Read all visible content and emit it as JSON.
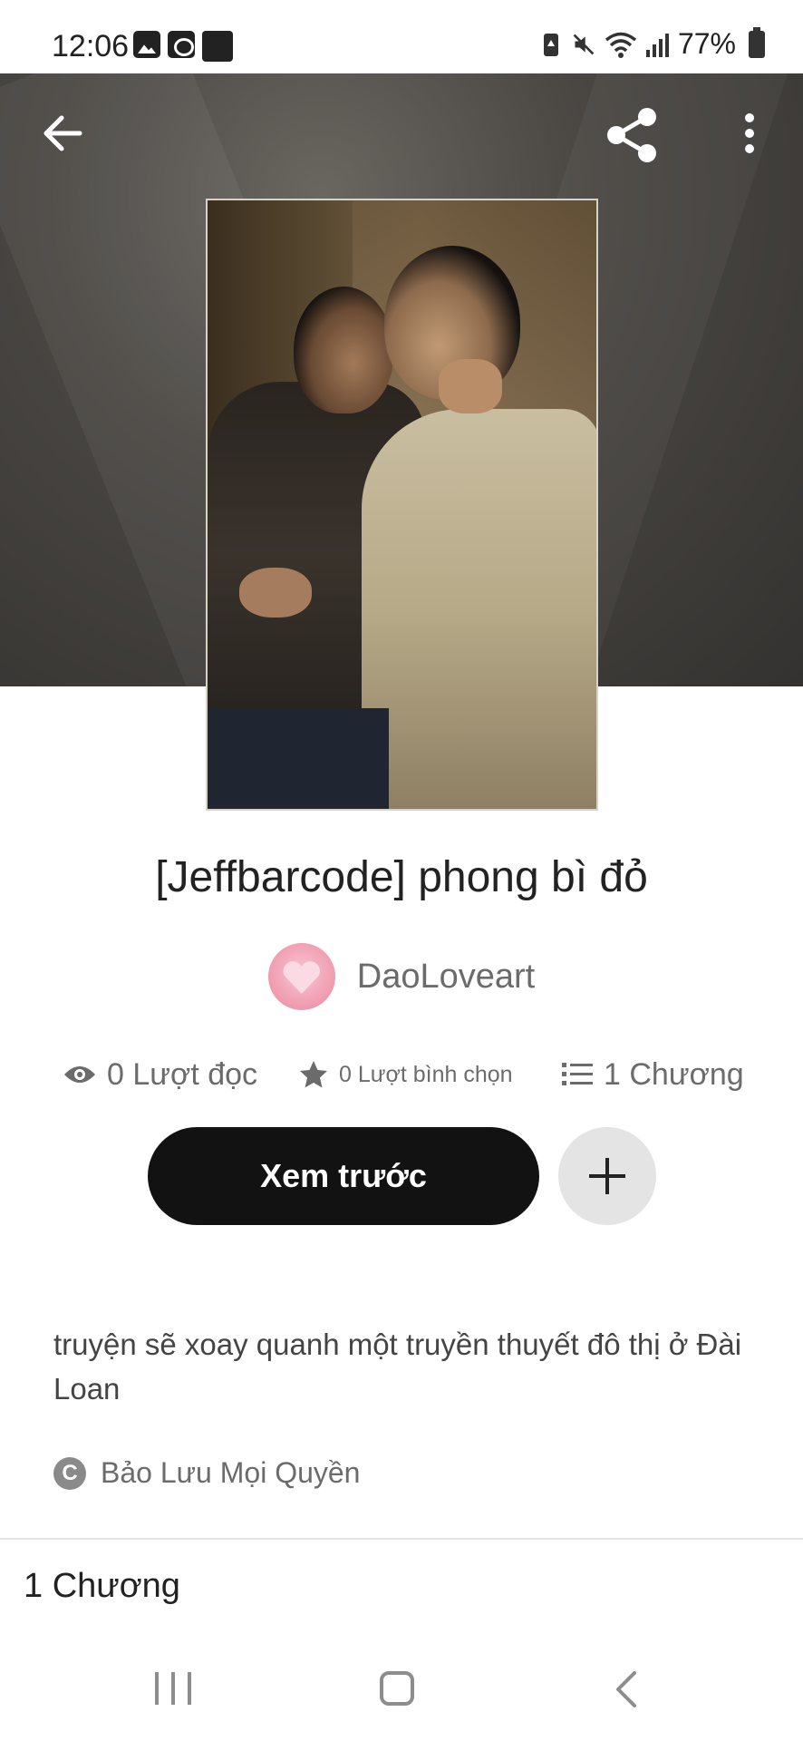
{
  "status_bar": {
    "time": "12:06",
    "battery": "77%",
    "left_icons": [
      "image-icon",
      "calendar-icon",
      "puzzle-icon"
    ],
    "right_icons": [
      "battery-saver-icon",
      "mute-icon",
      "wifi-icon",
      "signal-icon",
      "battery-icon"
    ]
  },
  "header": {
    "back_icon": "arrow-left-icon",
    "share_icon": "share-icon",
    "more_icon": "more-vert-icon"
  },
  "story": {
    "title": "[Jeffbarcode] phong bì đỏ",
    "author": "DaoLoveart",
    "stats": {
      "reads": "0 Lượt đọc",
      "votes": "0 Lượt bình chọn",
      "chapters": "1 Chương"
    },
    "preview_button": "Xem trước",
    "description": "truyện sẽ xoay quanh một truyền thuyết đô thị ở Đài Loan",
    "copyright": "Bảo Lưu Mọi Quyền",
    "chapters_heading": "1 Chương"
  },
  "colors": {
    "primary_button": "#121212",
    "secondary_button": "#e4e4e4",
    "muted_text": "#6b6b6b",
    "hero_background": "#4a4743"
  }
}
